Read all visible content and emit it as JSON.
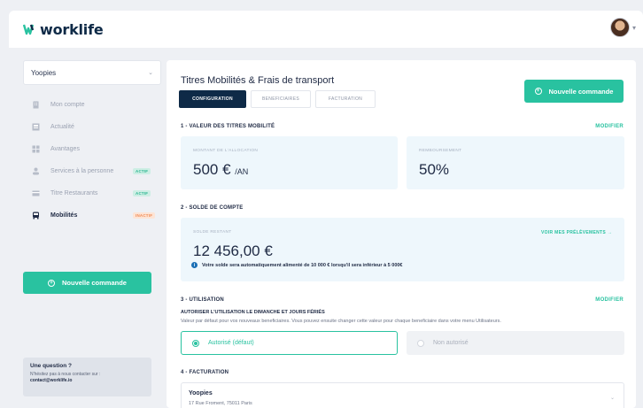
{
  "app": {
    "logo_text": "worklife",
    "brand_color": "#29c2a0",
    "navy_color": "#0e2a47"
  },
  "sidebar": {
    "company": "Yoopies",
    "items": [
      {
        "label": "Mon compte",
        "icon": "building-icon",
        "badge": ""
      },
      {
        "label": "Actualité",
        "icon": "newspaper-icon",
        "badge": ""
      },
      {
        "label": "Avantages",
        "icon": "grid-icon",
        "badge": ""
      },
      {
        "label": "Services à la personne",
        "icon": "person-icon",
        "badge": "ACTIF"
      },
      {
        "label": "Titre Restaurants",
        "icon": "card-icon",
        "badge": "ACTIF"
      },
      {
        "label": "Mobilités",
        "icon": "bus-icon",
        "badge": "INACTIF"
      }
    ],
    "order_button": "Nouvelle commande",
    "help": {
      "title": "Une question ?",
      "text": "N'hésitez pas à nous contacter sur :",
      "email": "contact@worklife.io"
    }
  },
  "main": {
    "title": "Titres Mobilités & Frais de transport",
    "tabs": [
      "CONFIGURATION",
      "BENEFICIAIRES",
      "FACTURATION"
    ],
    "order_button": "Nouvelle commande",
    "section1": {
      "title": "1 - VALEUR DES TITRES MOBILITÉ",
      "modify": "MODIFIER",
      "allocation_label": "MONTANT DE L'ALLOCATION",
      "allocation_value": "500 €",
      "allocation_unit": "/AN",
      "refund_label": "REMBOURSEMENT",
      "refund_value": "50%"
    },
    "section2": {
      "title": "2 - SOLDE DE COMPTE",
      "balance_label": "SOLDE RESTANT",
      "balance_value": "12 456,00 €",
      "see_link": "VOIR MES PRÉLÈVEMENTS →",
      "info": "Votre solde sera automatiquement alimenté de 10 000 € lorsqu'il sera inférieur à 5 000€"
    },
    "section3": {
      "title": "3 - UTILISATION",
      "modify": "MODIFIER",
      "subtitle": "AUTORISER L'UTILISATION LE DIMANCHE ET JOURS FÉRIÉS",
      "description": "Valeur par défaut pour vos nouveaux beneficiaires. Vous pouvez ensuite changer cette valeur pour chaque beneficiaire dans votre menu Utilisateurs.",
      "option_on": "Autorisé (défaut)",
      "option_off": "Non autorisé"
    },
    "section4": {
      "title": "4 - FACTURATION",
      "company": "Yoopies",
      "address": "17 Rue Froment, 75011 Paris"
    }
  }
}
